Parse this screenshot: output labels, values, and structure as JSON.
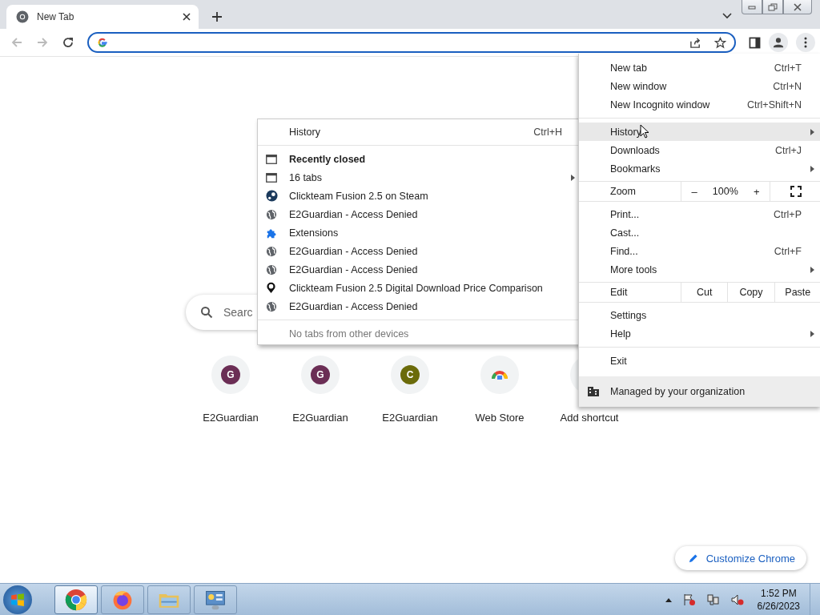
{
  "tabs": [
    {
      "title": "New Tab",
      "selected": true
    }
  ],
  "new_tab_page": {
    "search": {
      "placeholder": "Searc"
    },
    "shortcuts": [
      {
        "kind": "letter",
        "letter": "G",
        "color": "#6b2e55",
        "label": "E2Guardian"
      },
      {
        "kind": "letter",
        "letter": "G",
        "color": "#6b2e55",
        "label": "E2Guardian"
      },
      {
        "kind": "letter",
        "letter": "C",
        "color": "#6b6b0a",
        "label": "E2Guardian"
      },
      {
        "kind": "webstore",
        "label": "Web Store"
      },
      {
        "kind": "add",
        "label": "Add shortcut"
      }
    ],
    "customize_button": "Customize Chrome"
  },
  "history_menu": [
    {
      "kind": "link",
      "label": "History",
      "shortcut": "Ctrl+H"
    },
    {
      "kind": "separator"
    },
    {
      "kind": "heading",
      "label": "Recently closed"
    },
    {
      "kind": "window",
      "label": "16 tabs",
      "submenu": true
    },
    {
      "kind": "steam",
      "label": "Clickteam Fusion 2.5 on Steam"
    },
    {
      "kind": "globe",
      "label": "E2Guardian - Access Denied"
    },
    {
      "kind": "puzzle",
      "label": "Extensions"
    },
    {
      "kind": "globe",
      "label": "E2Guardian - Access Denied"
    },
    {
      "kind": "globe",
      "label": "E2Guardian - Access Denied"
    },
    {
      "kind": "pin",
      "label": "Clickteam Fusion 2.5 Digital Download Price Comparison"
    },
    {
      "kind": "globe",
      "label": "E2Guardian - Access Denied"
    },
    {
      "kind": "separator"
    },
    {
      "kind": "note",
      "label": "No tabs from other devices"
    }
  ],
  "app_menu": {
    "items": [
      {
        "kind": "item",
        "label": "New tab",
        "shortcut": "Ctrl+T",
        "highlighted": false
      },
      {
        "kind": "item",
        "label": "New window",
        "shortcut": "Ctrl+N",
        "highlighted": false
      },
      {
        "kind": "item",
        "label": "New Incognito window",
        "shortcut": "Ctrl+Shift+N",
        "highlighted": false
      },
      {
        "kind": "separator"
      },
      {
        "kind": "item",
        "label": "History",
        "submenu": true,
        "highlighted": true
      },
      {
        "kind": "item",
        "label": "Downloads",
        "shortcut": "Ctrl+J",
        "highlighted": false
      },
      {
        "kind": "item",
        "label": "Bookmarks",
        "submenu": true,
        "highlighted": false
      },
      {
        "kind": "zoom",
        "label": "Zoom",
        "minus": "–",
        "value": "100%",
        "plus": "+"
      },
      {
        "kind": "item",
        "label": "Print...",
        "shortcut": "Ctrl+P",
        "highlighted": false
      },
      {
        "kind": "item",
        "label": "Cast...",
        "highlighted": false
      },
      {
        "kind": "item",
        "label": "Find...",
        "shortcut": "Ctrl+F",
        "highlighted": false
      },
      {
        "kind": "item",
        "label": "More tools",
        "submenu": true,
        "highlighted": false
      },
      {
        "kind": "edit",
        "label": "Edit",
        "actions": [
          "Cut",
          "Copy",
          "Paste"
        ]
      },
      {
        "kind": "item",
        "label": "Settings",
        "highlighted": false
      },
      {
        "kind": "item",
        "label": "Help",
        "submenu": true,
        "highlighted": false
      },
      {
        "kind": "separator"
      },
      {
        "kind": "item",
        "label": "Exit",
        "highlighted": false
      }
    ],
    "managed": "Managed by your organization"
  },
  "taskbar": {
    "apps": [
      {
        "kind": "chrome",
        "selected": true
      },
      {
        "kind": "firefox",
        "selected": false
      },
      {
        "kind": "explorer",
        "selected": false
      },
      {
        "kind": "control-panel",
        "selected": false
      }
    ],
    "time": "1:52 PM",
    "date": "6/26/2023"
  }
}
